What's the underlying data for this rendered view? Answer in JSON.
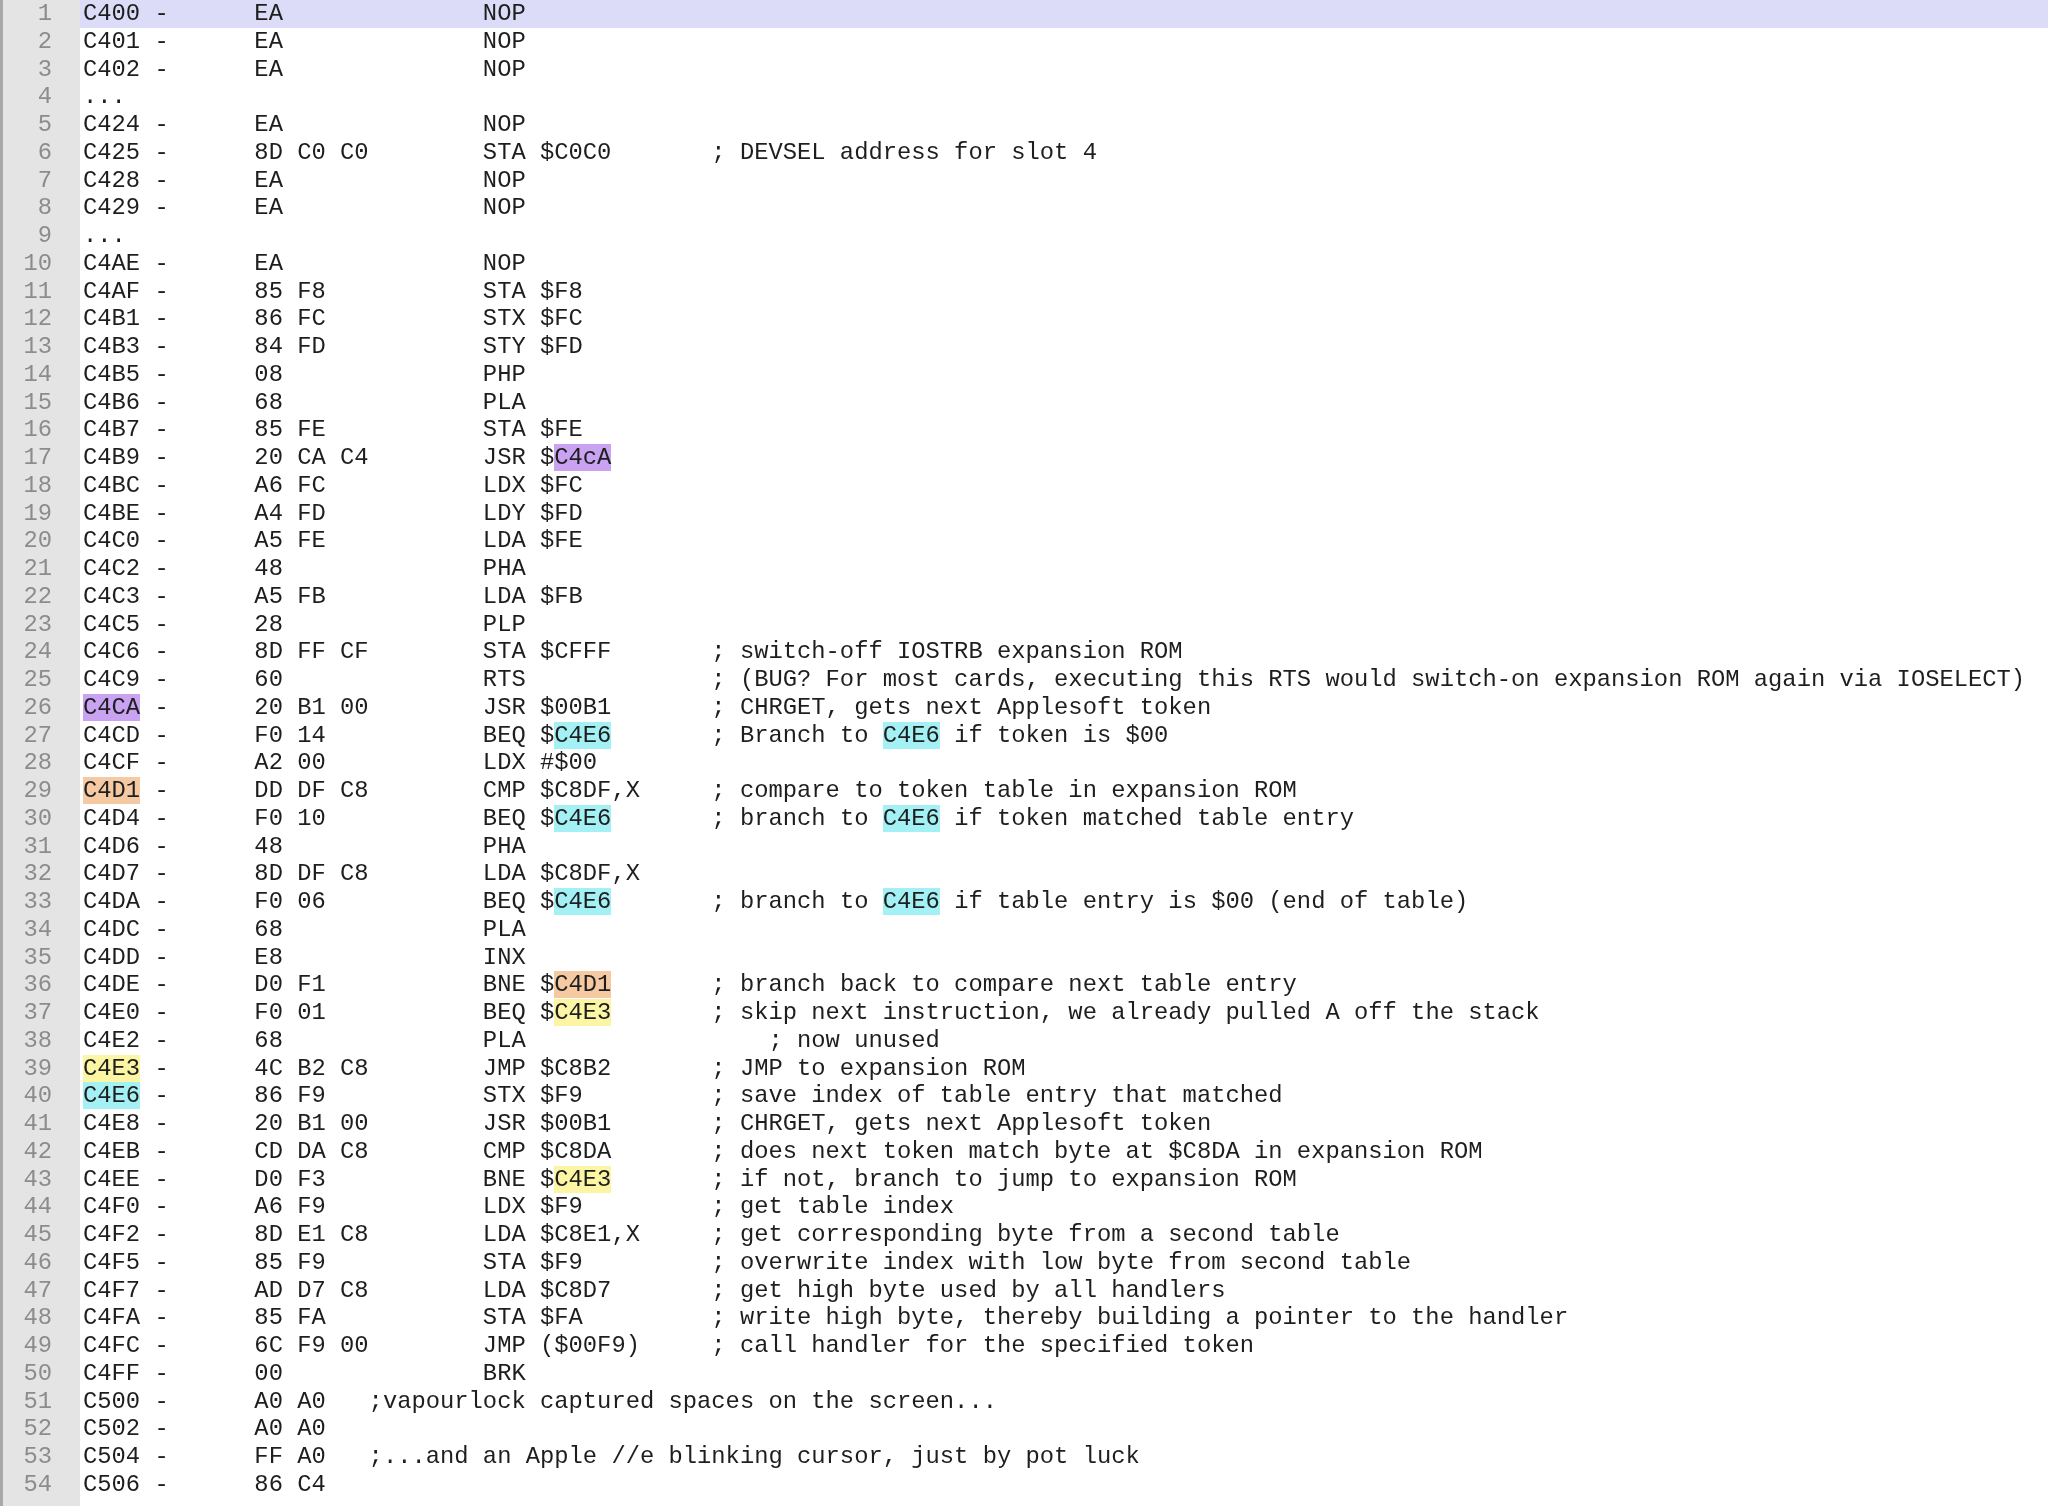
{
  "lines": [
    {
      "number": "1",
      "current": true,
      "segments": [
        {
          "text": "C400 -      EA              NOP"
        }
      ]
    },
    {
      "number": "2",
      "current": false,
      "segments": [
        {
          "text": "C401 -      EA              NOP"
        }
      ]
    },
    {
      "number": "3",
      "current": false,
      "segments": [
        {
          "text": "C402 -      EA              NOP"
        }
      ]
    },
    {
      "number": "4",
      "current": false,
      "segments": [
        {
          "text": "..."
        }
      ]
    },
    {
      "number": "5",
      "current": false,
      "segments": [
        {
          "text": "C424 -      EA              NOP"
        }
      ]
    },
    {
      "number": "6",
      "current": false,
      "segments": [
        {
          "text": "C425 -      8D C0 C0        STA $C0C0       ; DEVSEL address for slot 4"
        }
      ]
    },
    {
      "number": "7",
      "current": false,
      "segments": [
        {
          "text": "C428 -      EA              NOP"
        }
      ]
    },
    {
      "number": "8",
      "current": false,
      "segments": [
        {
          "text": "C429 -      EA              NOP"
        }
      ]
    },
    {
      "number": "9",
      "current": false,
      "segments": [
        {
          "text": "..."
        }
      ]
    },
    {
      "number": "10",
      "current": false,
      "segments": [
        {
          "text": "C4AE -      EA              NOP"
        }
      ]
    },
    {
      "number": "11",
      "current": false,
      "segments": [
        {
          "text": "C4AF -      85 F8           STA $F8"
        }
      ]
    },
    {
      "number": "12",
      "current": false,
      "segments": [
        {
          "text": "C4B1 -      86 FC           STX $FC"
        }
      ]
    },
    {
      "number": "13",
      "current": false,
      "segments": [
        {
          "text": "C4B3 -      84 FD           STY $FD"
        }
      ]
    },
    {
      "number": "14",
      "current": false,
      "segments": [
        {
          "text": "C4B5 -      08              PHP"
        }
      ]
    },
    {
      "number": "15",
      "current": false,
      "segments": [
        {
          "text": "C4B6 -      68              PLA"
        }
      ]
    },
    {
      "number": "16",
      "current": false,
      "segments": [
        {
          "text": "C4B7 -      85 FE           STA $FE"
        }
      ]
    },
    {
      "number": "17",
      "current": false,
      "segments": [
        {
          "text": "C4B9 -      20 CA C4        JSR $"
        },
        {
          "text": "C4cA",
          "color": "#c9a3f2"
        }
      ]
    },
    {
      "number": "18",
      "current": false,
      "segments": [
        {
          "text": "C4BC -      A6 FC           LDX $FC"
        }
      ]
    },
    {
      "number": "19",
      "current": false,
      "segments": [
        {
          "text": "C4BE -      A4 FD           LDY $FD"
        }
      ]
    },
    {
      "number": "20",
      "current": false,
      "segments": [
        {
          "text": "C4C0 -      A5 FE           LDA $FE"
        }
      ]
    },
    {
      "number": "21",
      "current": false,
      "segments": [
        {
          "text": "C4C2 -      48              PHA"
        }
      ]
    },
    {
      "number": "22",
      "current": false,
      "segments": [
        {
          "text": "C4C3 -      A5 FB           LDA $FB"
        }
      ]
    },
    {
      "number": "23",
      "current": false,
      "segments": [
        {
          "text": "C4C5 -      28              PLP"
        }
      ]
    },
    {
      "number": "24",
      "current": false,
      "segments": [
        {
          "text": "C4C6 -      8D FF CF        STA $CFFF       ; switch-off IOSTRB expansion ROM"
        }
      ]
    },
    {
      "number": "25",
      "current": false,
      "segments": [
        {
          "text": "C4C9 -      60              RTS             ; (BUG? For most cards, executing this RTS would switch-on expansion ROM again via IOSELECT)"
        }
      ]
    },
    {
      "number": "26",
      "current": false,
      "segments": [
        {
          "text": "C4CA",
          "color": "#c9a3f2"
        },
        {
          "text": " -      20 B1 00        JSR $00B1       ; CHRGET, gets next Applesoft token"
        }
      ]
    },
    {
      "number": "27",
      "current": false,
      "segments": [
        {
          "text": "C4CD -      F0 14           BEQ $"
        },
        {
          "text": "C4E6",
          "color": "#a3f1f5"
        },
        {
          "text": "       ; Branch to "
        },
        {
          "text": "C4E6",
          "color": "#a3f1f5"
        },
        {
          "text": " if token is $00"
        }
      ]
    },
    {
      "number": "28",
      "current": false,
      "segments": [
        {
          "text": "C4CF -      A2 00           LDX #$00"
        }
      ]
    },
    {
      "number": "29",
      "current": false,
      "segments": [
        {
          "text": "C4D1",
          "color": "#f5c9a2"
        },
        {
          "text": " -      DD DF C8        CMP $C8DF,X     ; compare to token table in expansion ROM"
        }
      ]
    },
    {
      "number": "30",
      "current": false,
      "segments": [
        {
          "text": "C4D4 -      F0 10           BEQ $"
        },
        {
          "text": "C4E6",
          "color": "#a3f1f5"
        },
        {
          "text": "       ; branch to "
        },
        {
          "text": "C4E6",
          "color": "#a3f1f5"
        },
        {
          "text": " if token matched table entry"
        }
      ]
    },
    {
      "number": "31",
      "current": false,
      "segments": [
        {
          "text": "C4D6 -      48              PHA"
        }
      ]
    },
    {
      "number": "32",
      "current": false,
      "segments": [
        {
          "text": "C4D7 -      8D DF C8        LDA $C8DF,X"
        }
      ]
    },
    {
      "number": "33",
      "current": false,
      "segments": [
        {
          "text": "C4DA -      F0 06           BEQ $"
        },
        {
          "text": "C4E6",
          "color": "#a3f1f5"
        },
        {
          "text": "       ; branch to "
        },
        {
          "text": "C4E6",
          "color": "#a3f1f5"
        },
        {
          "text": " if table entry is $00 (end of table)"
        }
      ]
    },
    {
      "number": "34",
      "current": false,
      "segments": [
        {
          "text": "C4DC -      68              PLA"
        }
      ]
    },
    {
      "number": "35",
      "current": false,
      "segments": [
        {
          "text": "C4DD -      E8              INX"
        }
      ]
    },
    {
      "number": "36",
      "current": false,
      "segments": [
        {
          "text": "C4DE -      D0 F1           BNE $"
        },
        {
          "text": "C4D1",
          "color": "#f5c9a2"
        },
        {
          "text": "       ; branch back to compare next table entry"
        }
      ]
    },
    {
      "number": "37",
      "current": false,
      "segments": [
        {
          "text": "C4E0 -      F0 01           BEQ $"
        },
        {
          "text": "C4E3",
          "color": "#fcf5a3"
        },
        {
          "text": "       ; skip next instruction, we already pulled A off the stack"
        }
      ]
    },
    {
      "number": "38",
      "current": false,
      "segments": [
        {
          "text": "C4E2 -      68              PLA                 ; now unused"
        }
      ]
    },
    {
      "number": "39",
      "current": false,
      "segments": [
        {
          "text": "C4E3",
          "color": "#fcf5a3"
        },
        {
          "text": " -      4C B2 C8        JMP $C8B2       ; JMP to expansion ROM"
        }
      ]
    },
    {
      "number": "40",
      "current": false,
      "segments": [
        {
          "text": "C4E6",
          "color": "#a3f1f5"
        },
        {
          "text": " -      86 F9           STX $F9         ; save index of table entry that matched"
        }
      ]
    },
    {
      "number": "41",
      "current": false,
      "segments": [
        {
          "text": "C4E8 -      20 B1 00        JSR $00B1       ; CHRGET, gets next Applesoft token"
        }
      ]
    },
    {
      "number": "42",
      "current": false,
      "segments": [
        {
          "text": "C4EB -      CD DA C8        CMP $C8DA       ; does next token match byte at $C8DA in expansion ROM"
        }
      ]
    },
    {
      "number": "43",
      "current": false,
      "segments": [
        {
          "text": "C4EE -      D0 F3           BNE $"
        },
        {
          "text": "C4E3",
          "color": "#fcf5a3"
        },
        {
          "text": "       ; if not, branch to jump to expansion ROM"
        }
      ]
    },
    {
      "number": "44",
      "current": false,
      "segments": [
        {
          "text": "C4F0 -      A6 F9           LDX $F9         ; get table index"
        }
      ]
    },
    {
      "number": "45",
      "current": false,
      "segments": [
        {
          "text": "C4F2 -      8D E1 C8        LDA $C8E1,X     ; get corresponding byte from a second table"
        }
      ]
    },
    {
      "number": "46",
      "current": false,
      "segments": [
        {
          "text": "C4F5 -      85 F9           STA $F9         ; overwrite index with low byte from second table"
        }
      ]
    },
    {
      "number": "47",
      "current": false,
      "segments": [
        {
          "text": "C4F7 -      AD D7 C8        LDA $C8D7       ; get high byte used by all handlers"
        }
      ]
    },
    {
      "number": "48",
      "current": false,
      "segments": [
        {
          "text": "C4FA -      85 FA           STA $FA         ; write high byte, thereby building a pointer to the handler"
        }
      ]
    },
    {
      "number": "49",
      "current": false,
      "segments": [
        {
          "text": "C4FC -      6C F9 00        JMP ($00F9)     ; call handler for the specified token"
        }
      ]
    },
    {
      "number": "50",
      "current": false,
      "segments": [
        {
          "text": "C4FF -      00              BRK"
        }
      ]
    },
    {
      "number": "51",
      "current": false,
      "segments": [
        {
          "text": "C500 -      A0 A0   ;vapourlock captured spaces on the screen..."
        }
      ]
    },
    {
      "number": "52",
      "current": false,
      "segments": [
        {
          "text": "C502 -      A0 A0"
        }
      ]
    },
    {
      "number": "53",
      "current": false,
      "segments": [
        {
          "text": "C504 -      FF A0   ;...and an Apple //e blinking cursor, just by pot luck"
        }
      ]
    },
    {
      "number": "54",
      "current": false,
      "segments": [
        {
          "text": "C506 -      86 C4"
        }
      ]
    }
  ]
}
